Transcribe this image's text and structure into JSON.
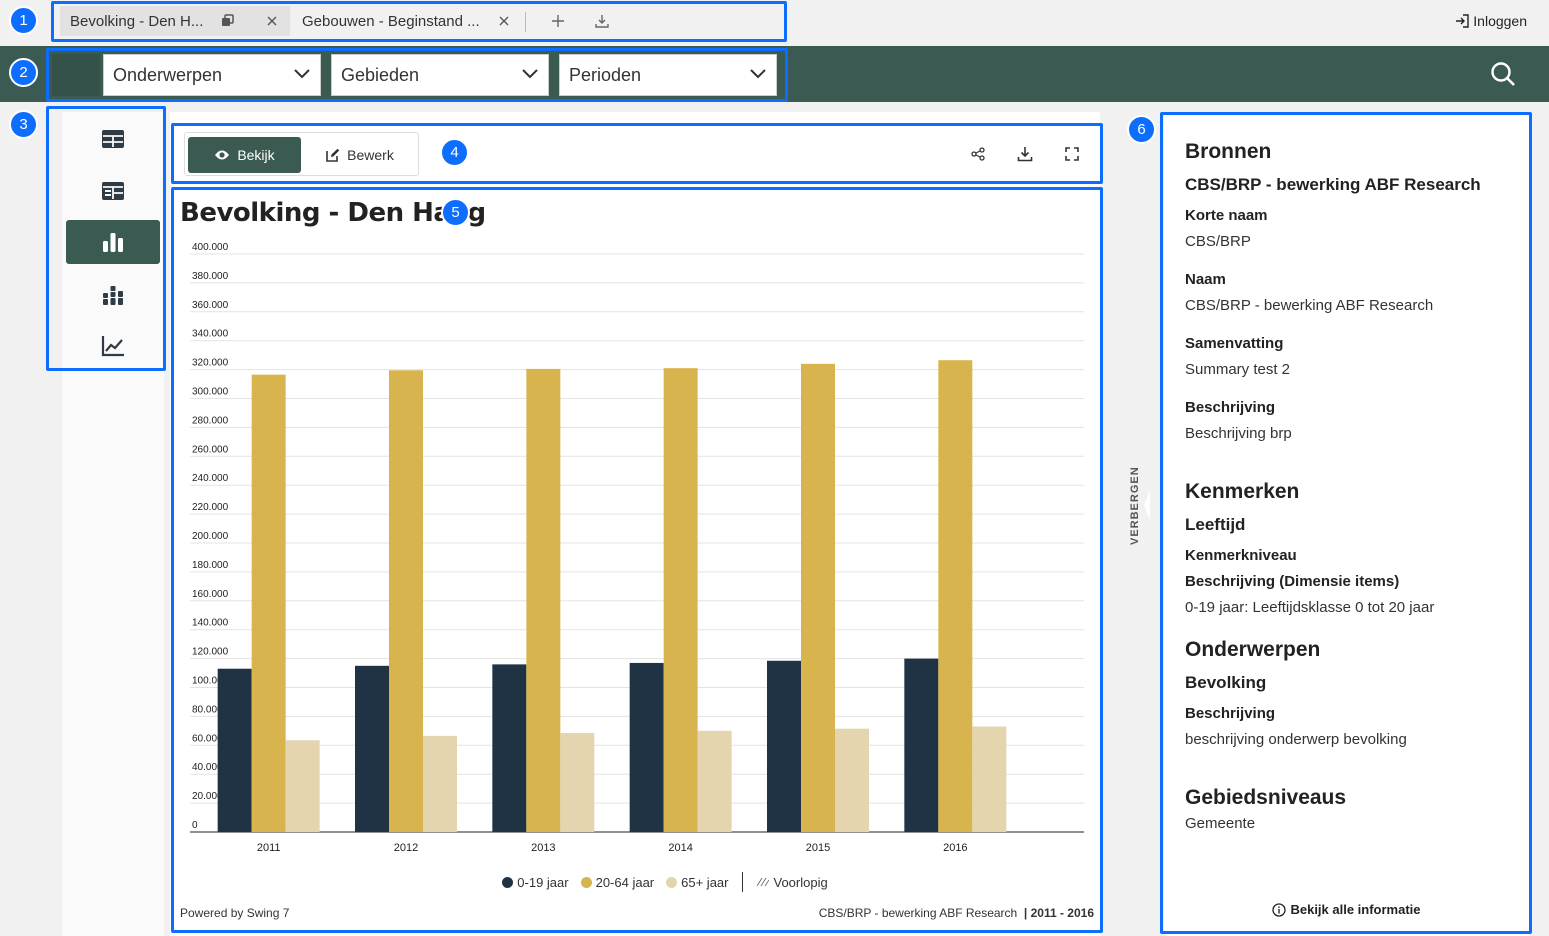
{
  "tabs": [
    {
      "label": "Bevolking - Den H..."
    },
    {
      "label": "Gebouwen - Beginstand ..."
    }
  ],
  "login_label": "Inloggen",
  "nav": {
    "dropdowns": [
      "Onderwerpen",
      "Gebieden",
      "Perioden"
    ]
  },
  "view_toggle": {
    "view_label": "Bekijk",
    "edit_label": "Bewerk"
  },
  "chart_title": "Bevolking - Den Haag",
  "chart_data": {
    "type": "bar",
    "title": "Bevolking - Den Haag",
    "categories": [
      "2011",
      "2012",
      "2013",
      "2014",
      "2015",
      "2016"
    ],
    "series": [
      {
        "name": "0-19 jaar",
        "color": "#1f3344",
        "values": [
          113000,
          115000,
          116000,
          117000,
          118500,
          120000
        ]
      },
      {
        "name": "20-64 jaar",
        "color": "#d8b44f",
        "values": [
          316500,
          319500,
          320500,
          321000,
          324000,
          326500
        ]
      },
      {
        "name": "65+ jaar",
        "color": "#e4d5ae",
        "values": [
          63500,
          66500,
          68500,
          70000,
          71500,
          73000
        ]
      }
    ],
    "yticks": [
      "400.000",
      "380.000",
      "360.000",
      "340.000",
      "320.000",
      "300.000",
      "280.000",
      "260.000",
      "240.000",
      "220.000",
      "200.000",
      "180.000",
      "160.000",
      "140.000",
      "120.000",
      "100.000",
      "80.000",
      "60.000",
      "40.000",
      "20.000",
      "0"
    ],
    "ylim": [
      0,
      400000
    ],
    "grid": true,
    "legend_position": "bottom",
    "legend_extra": "Voorlopig"
  },
  "footer": {
    "powered": "Powered by Swing 7",
    "source": "CBS/BRP - bewerking ABF Research",
    "period": "| 2011 - 2016"
  },
  "hide_label": "VERBERGEN",
  "info": {
    "bronnen_title": "Bronnen",
    "bron_name": "CBS/BRP - bewerking ABF Research",
    "korte_naam_label": "Korte naam",
    "korte_naam_value": "CBS/BRP",
    "naam_label": "Naam",
    "naam_value": "CBS/BRP - bewerking ABF Research",
    "samenvatting_label": "Samenvatting",
    "samenvatting_value": "Summary test 2",
    "beschrijving_label": "Beschrijving",
    "beschrijving_value": "Beschrijving brp",
    "kenmerken_title": "Kenmerken",
    "kenmerk_name": "Leeftijd",
    "kenmerkniveau_label": "Kenmerkniveau",
    "dim_label": "Beschrijving (Dimensie items)",
    "dim_value": "0-19 jaar: Leeftijdsklasse 0 tot 20 jaar",
    "onderwerpen_title": "Onderwerpen",
    "onderwerp_name": "Bevolking",
    "onderwerp_besch_label": "Beschrijving",
    "onderwerp_besch_value": "beschrijving onderwerp bevolking",
    "gebiedsniveaus_title": "Gebiedsniveaus",
    "gebiedsniveau_value": "Gemeente",
    "all_info": "Bekijk alle informatie"
  },
  "annotations": [
    "1",
    "2",
    "3",
    "4",
    "5",
    "6"
  ]
}
